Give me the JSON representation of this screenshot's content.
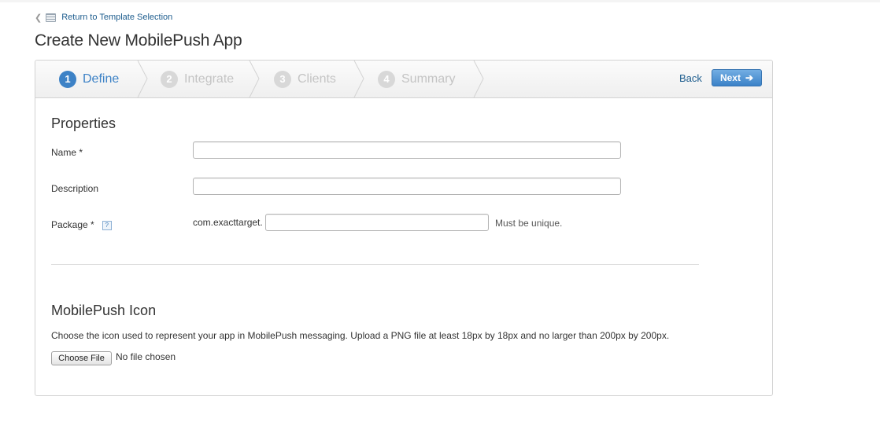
{
  "back_link": {
    "label": "Return to Template Selection"
  },
  "page_title": "Create New MobilePush App",
  "wizard": {
    "steps": [
      {
        "number": "1",
        "label": "Define",
        "state": "active"
      },
      {
        "number": "2",
        "label": "Integrate",
        "state": "inactive"
      },
      {
        "number": "3",
        "label": "Clients",
        "state": "inactive"
      },
      {
        "number": "4",
        "label": "Summary",
        "state": "inactive"
      }
    ],
    "back_label": "Back",
    "next_label": "Next",
    "accent_color": "#3d82c6"
  },
  "properties": {
    "title": "Properties",
    "name": {
      "label": "Name *",
      "value": ""
    },
    "description": {
      "label": "Description",
      "value": ""
    },
    "package": {
      "label": "Package *",
      "help": "?",
      "prefix": "com.exacttarget.",
      "value": "",
      "note": "Must be unique."
    }
  },
  "icon_section": {
    "title": "MobilePush Icon",
    "description": "Choose the icon used to represent your app in MobilePush messaging. Upload a PNG file at least 18px by 18px and no larger than 200px by 200px.",
    "choose_file_label": "Choose File",
    "file_status": "No file chosen"
  }
}
